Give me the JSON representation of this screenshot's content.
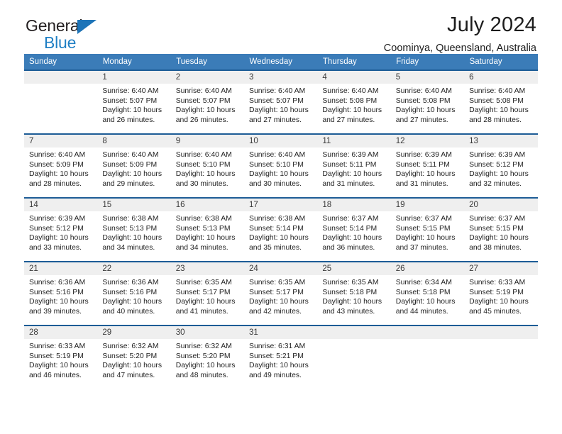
{
  "brand": {
    "name_top": "General",
    "name_bottom": "Blue",
    "triangle_color": "#1d74b8",
    "text_color": "#231f20",
    "accent_color": "#1f7fc4"
  },
  "header": {
    "title": "July 2024",
    "location": "Coominya, Queensland, Australia"
  },
  "theme": {
    "header_row_bg": "#3b7cb8",
    "header_row_text": "#ffffff",
    "row_divider": "#1d5c96",
    "daynum_band_bg": "#efefef"
  },
  "calendar": {
    "weekday_headers": [
      "Sunday",
      "Monday",
      "Tuesday",
      "Wednesday",
      "Thursday",
      "Friday",
      "Saturday"
    ],
    "labels": {
      "sunrise": "Sunrise:",
      "sunset": "Sunset:",
      "daylight": "Daylight:"
    },
    "weeks": [
      [
        {
          "day": ""
        },
        {
          "day": "1",
          "sunrise": "Sunrise: 6:40 AM",
          "sunset": "Sunset: 5:07 PM",
          "daylight_line1": "Daylight: 10 hours",
          "daylight_line2": "and 26 minutes."
        },
        {
          "day": "2",
          "sunrise": "Sunrise: 6:40 AM",
          "sunset": "Sunset: 5:07 PM",
          "daylight_line1": "Daylight: 10 hours",
          "daylight_line2": "and 26 minutes."
        },
        {
          "day": "3",
          "sunrise": "Sunrise: 6:40 AM",
          "sunset": "Sunset: 5:07 PM",
          "daylight_line1": "Daylight: 10 hours",
          "daylight_line2": "and 27 minutes."
        },
        {
          "day": "4",
          "sunrise": "Sunrise: 6:40 AM",
          "sunset": "Sunset: 5:08 PM",
          "daylight_line1": "Daylight: 10 hours",
          "daylight_line2": "and 27 minutes."
        },
        {
          "day": "5",
          "sunrise": "Sunrise: 6:40 AM",
          "sunset": "Sunset: 5:08 PM",
          "daylight_line1": "Daylight: 10 hours",
          "daylight_line2": "and 27 minutes."
        },
        {
          "day": "6",
          "sunrise": "Sunrise: 6:40 AM",
          "sunset": "Sunset: 5:08 PM",
          "daylight_line1": "Daylight: 10 hours",
          "daylight_line2": "and 28 minutes."
        }
      ],
      [
        {
          "day": "7",
          "sunrise": "Sunrise: 6:40 AM",
          "sunset": "Sunset: 5:09 PM",
          "daylight_line1": "Daylight: 10 hours",
          "daylight_line2": "and 28 minutes."
        },
        {
          "day": "8",
          "sunrise": "Sunrise: 6:40 AM",
          "sunset": "Sunset: 5:09 PM",
          "daylight_line1": "Daylight: 10 hours",
          "daylight_line2": "and 29 minutes."
        },
        {
          "day": "9",
          "sunrise": "Sunrise: 6:40 AM",
          "sunset": "Sunset: 5:10 PM",
          "daylight_line1": "Daylight: 10 hours",
          "daylight_line2": "and 30 minutes."
        },
        {
          "day": "10",
          "sunrise": "Sunrise: 6:40 AM",
          "sunset": "Sunset: 5:10 PM",
          "daylight_line1": "Daylight: 10 hours",
          "daylight_line2": "and 30 minutes."
        },
        {
          "day": "11",
          "sunrise": "Sunrise: 6:39 AM",
          "sunset": "Sunset: 5:11 PM",
          "daylight_line1": "Daylight: 10 hours",
          "daylight_line2": "and 31 minutes."
        },
        {
          "day": "12",
          "sunrise": "Sunrise: 6:39 AM",
          "sunset": "Sunset: 5:11 PM",
          "daylight_line1": "Daylight: 10 hours",
          "daylight_line2": "and 31 minutes."
        },
        {
          "day": "13",
          "sunrise": "Sunrise: 6:39 AM",
          "sunset": "Sunset: 5:12 PM",
          "daylight_line1": "Daylight: 10 hours",
          "daylight_line2": "and 32 minutes."
        }
      ],
      [
        {
          "day": "14",
          "sunrise": "Sunrise: 6:39 AM",
          "sunset": "Sunset: 5:12 PM",
          "daylight_line1": "Daylight: 10 hours",
          "daylight_line2": "and 33 minutes."
        },
        {
          "day": "15",
          "sunrise": "Sunrise: 6:38 AM",
          "sunset": "Sunset: 5:13 PM",
          "daylight_line1": "Daylight: 10 hours",
          "daylight_line2": "and 34 minutes."
        },
        {
          "day": "16",
          "sunrise": "Sunrise: 6:38 AM",
          "sunset": "Sunset: 5:13 PM",
          "daylight_line1": "Daylight: 10 hours",
          "daylight_line2": "and 34 minutes."
        },
        {
          "day": "17",
          "sunrise": "Sunrise: 6:38 AM",
          "sunset": "Sunset: 5:14 PM",
          "daylight_line1": "Daylight: 10 hours",
          "daylight_line2": "and 35 minutes."
        },
        {
          "day": "18",
          "sunrise": "Sunrise: 6:37 AM",
          "sunset": "Sunset: 5:14 PM",
          "daylight_line1": "Daylight: 10 hours",
          "daylight_line2": "and 36 minutes."
        },
        {
          "day": "19",
          "sunrise": "Sunrise: 6:37 AM",
          "sunset": "Sunset: 5:15 PM",
          "daylight_line1": "Daylight: 10 hours",
          "daylight_line2": "and 37 minutes."
        },
        {
          "day": "20",
          "sunrise": "Sunrise: 6:37 AM",
          "sunset": "Sunset: 5:15 PM",
          "daylight_line1": "Daylight: 10 hours",
          "daylight_line2": "and 38 minutes."
        }
      ],
      [
        {
          "day": "21",
          "sunrise": "Sunrise: 6:36 AM",
          "sunset": "Sunset: 5:16 PM",
          "daylight_line1": "Daylight: 10 hours",
          "daylight_line2": "and 39 minutes."
        },
        {
          "day": "22",
          "sunrise": "Sunrise: 6:36 AM",
          "sunset": "Sunset: 5:16 PM",
          "daylight_line1": "Daylight: 10 hours",
          "daylight_line2": "and 40 minutes."
        },
        {
          "day": "23",
          "sunrise": "Sunrise: 6:35 AM",
          "sunset": "Sunset: 5:17 PM",
          "daylight_line1": "Daylight: 10 hours",
          "daylight_line2": "and 41 minutes."
        },
        {
          "day": "24",
          "sunrise": "Sunrise: 6:35 AM",
          "sunset": "Sunset: 5:17 PM",
          "daylight_line1": "Daylight: 10 hours",
          "daylight_line2": "and 42 minutes."
        },
        {
          "day": "25",
          "sunrise": "Sunrise: 6:35 AM",
          "sunset": "Sunset: 5:18 PM",
          "daylight_line1": "Daylight: 10 hours",
          "daylight_line2": "and 43 minutes."
        },
        {
          "day": "26",
          "sunrise": "Sunrise: 6:34 AM",
          "sunset": "Sunset: 5:18 PM",
          "daylight_line1": "Daylight: 10 hours",
          "daylight_line2": "and 44 minutes."
        },
        {
          "day": "27",
          "sunrise": "Sunrise: 6:33 AM",
          "sunset": "Sunset: 5:19 PM",
          "daylight_line1": "Daylight: 10 hours",
          "daylight_line2": "and 45 minutes."
        }
      ],
      [
        {
          "day": "28",
          "sunrise": "Sunrise: 6:33 AM",
          "sunset": "Sunset: 5:19 PM",
          "daylight_line1": "Daylight: 10 hours",
          "daylight_line2": "and 46 minutes."
        },
        {
          "day": "29",
          "sunrise": "Sunrise: 6:32 AM",
          "sunset": "Sunset: 5:20 PM",
          "daylight_line1": "Daylight: 10 hours",
          "daylight_line2": "and 47 minutes."
        },
        {
          "day": "30",
          "sunrise": "Sunrise: 6:32 AM",
          "sunset": "Sunset: 5:20 PM",
          "daylight_line1": "Daylight: 10 hours",
          "daylight_line2": "and 48 minutes."
        },
        {
          "day": "31",
          "sunrise": "Sunrise: 6:31 AM",
          "sunset": "Sunset: 5:21 PM",
          "daylight_line1": "Daylight: 10 hours",
          "daylight_line2": "and 49 minutes."
        },
        {
          "day": ""
        },
        {
          "day": ""
        },
        {
          "day": ""
        }
      ]
    ]
  }
}
